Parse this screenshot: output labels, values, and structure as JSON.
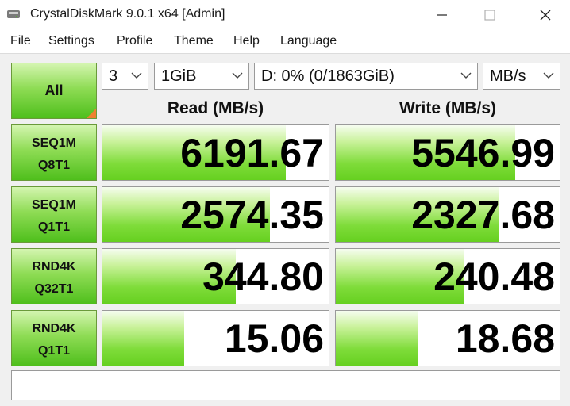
{
  "window": {
    "title": "CrystalDiskMark 9.0.1 x64 [Admin]"
  },
  "menu": {
    "items": [
      "File",
      "Settings",
      "Profile",
      "Theme",
      "Help",
      "Language"
    ]
  },
  "controls": {
    "all_label": "All",
    "count": "3",
    "size": "1GiB",
    "drive": "D: 0% (0/1863GiB)",
    "unit": "MB/s"
  },
  "headers": {
    "read": "Read (MB/s)",
    "write": "Write (MB/s)"
  },
  "tests": [
    {
      "line1": "SEQ1M",
      "line2": "Q8T1",
      "read": "6191.67",
      "write": "5546.99",
      "read_fill": 0.81,
      "write_fill": 0.8
    },
    {
      "line1": "SEQ1M",
      "line2": "Q1T1",
      "read": "2574.35",
      "write": "2327.68",
      "read_fill": 0.74,
      "write_fill": 0.73
    },
    {
      "line1": "RND4K",
      "line2": "Q32T1",
      "read": "344.80",
      "write": "240.48",
      "read_fill": 0.59,
      "write_fill": 0.57
    },
    {
      "line1": "RND4K",
      "line2": "Q1T1",
      "read": "15.06",
      "write": "18.68",
      "read_fill": 0.36,
      "write_fill": 0.37
    }
  ],
  "comment": "",
  "colors": {
    "accent_green": "#66d020",
    "corner_orange": "#f08030"
  }
}
